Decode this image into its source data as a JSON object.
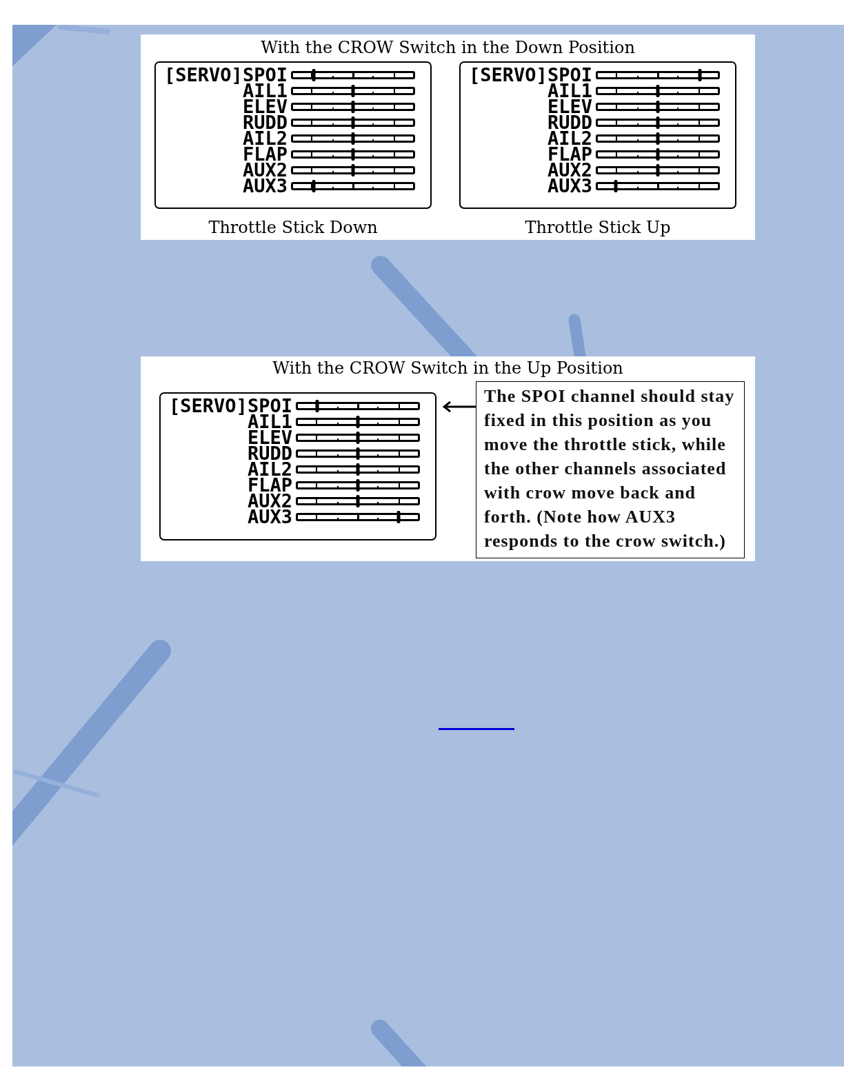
{
  "panels": [
    {
      "title": "With the CROW Switch in the Down Position",
      "screens": [
        {
          "header": "[SERVO]",
          "channels": [
            {
              "name": "SPOI",
              "level": 0.17
            },
            {
              "name": "AIL1",
              "level": 0.5
            },
            {
              "name": "ELEV",
              "level": 0.5
            },
            {
              "name": "RUDD",
              "level": 0.5
            },
            {
              "name": "AIL2",
              "level": 0.5
            },
            {
              "name": "FLAP",
              "level": 0.5
            },
            {
              "name": "AUX2",
              "level": 0.5
            },
            {
              "name": "AUX3",
              "level": 0.17
            }
          ],
          "caption": "Throttle Stick Down"
        },
        {
          "header": "[SERVO]",
          "channels": [
            {
              "name": "SPOI",
              "level": 0.85
            },
            {
              "name": "AIL1",
              "level": 0.5
            },
            {
              "name": "ELEV",
              "level": 0.5
            },
            {
              "name": "RUDD",
              "level": 0.5
            },
            {
              "name": "AIL2",
              "level": 0.5
            },
            {
              "name": "FLAP",
              "level": 0.5
            },
            {
              "name": "AUX2",
              "level": 0.5
            },
            {
              "name": "AUX3",
              "level": 0.15
            }
          ],
          "caption": "Throttle Stick Up"
        }
      ]
    },
    {
      "title": "With the CROW Switch in the Up Position",
      "screens": [
        {
          "header": "[SERVO]",
          "channels": [
            {
              "name": "SPOI",
              "level": 0.16
            },
            {
              "name": "AIL1",
              "level": 0.5
            },
            {
              "name": "ELEV",
              "level": 0.5
            },
            {
              "name": "RUDD",
              "level": 0.5
            },
            {
              "name": "AIL2",
              "level": 0.5
            },
            {
              "name": "FLAP",
              "level": 0.5
            },
            {
              "name": "AUX2",
              "level": 0.5
            },
            {
              "name": "AUX3",
              "level": 0.84
            }
          ]
        }
      ],
      "callout": {
        "lines": [
          "The SPOI channel should stay",
          "fixed in this position as you",
          "move the throttle stick, while",
          "the other channels associated",
          "with crow move back and",
          "forth. (Note how AUX3",
          "responds to the crow switch.)"
        ]
      }
    }
  ]
}
